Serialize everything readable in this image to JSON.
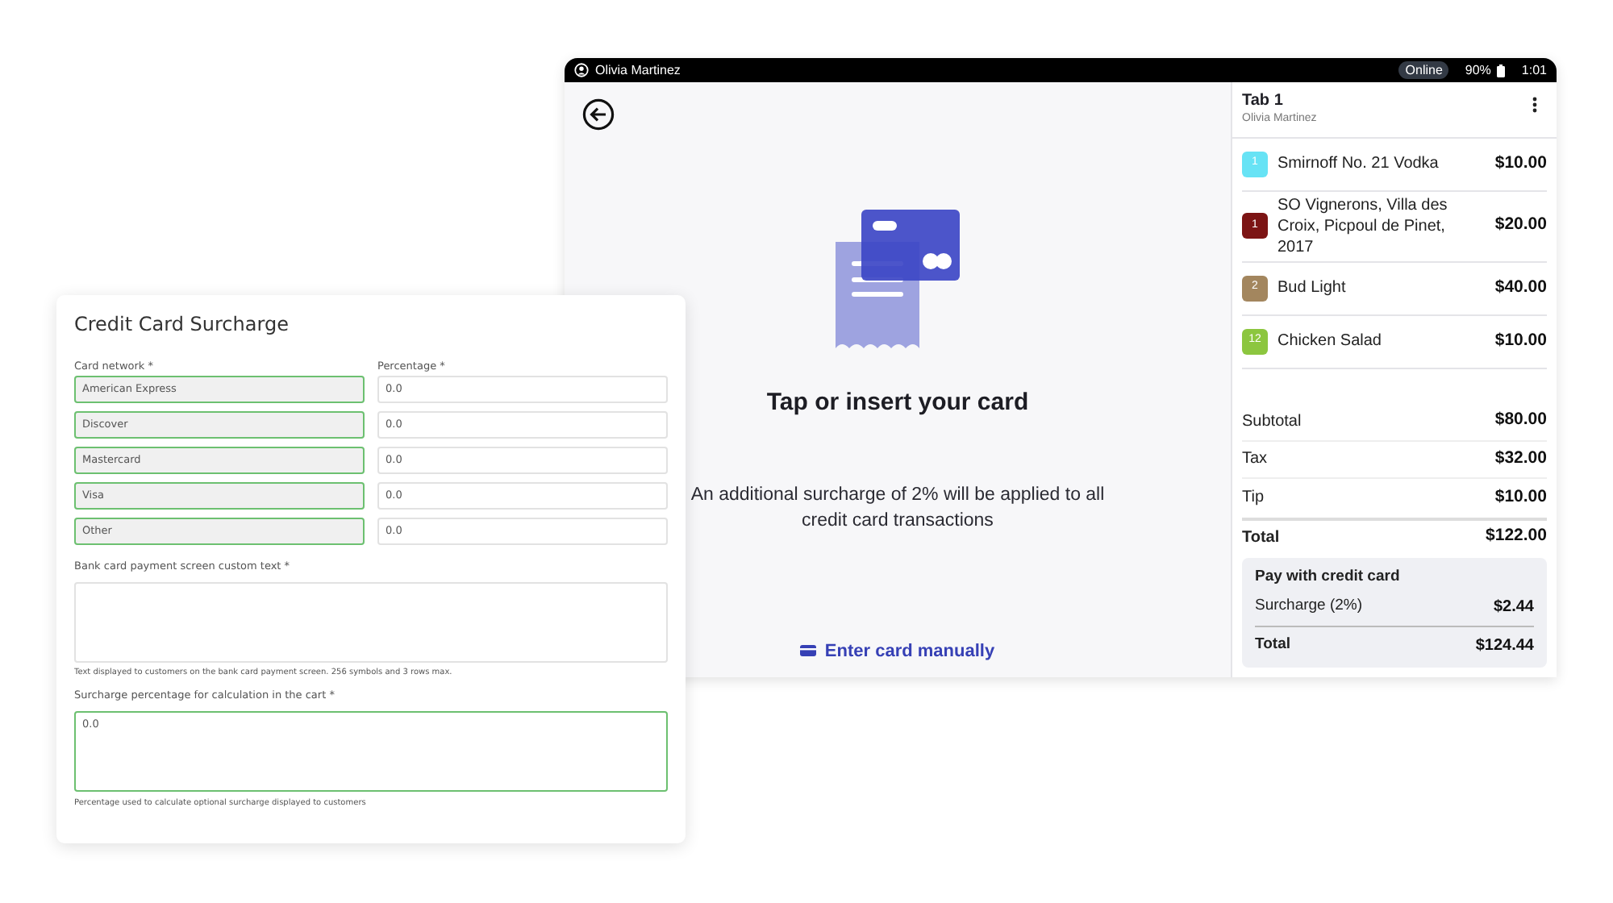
{
  "tablet": {
    "status_bar": {
      "user": "Olivia Martinez",
      "connection": "Online",
      "battery": "90%",
      "time": "1:01"
    },
    "payment": {
      "title": "Tap or insert your card",
      "message": "An additional surcharge of 2% will be applied to all credit card transactions",
      "manual_link": "Enter card manually"
    },
    "tab": {
      "title": "Tab 1",
      "customer": "Olivia Martinez",
      "items": [
        {
          "quantity": "1",
          "name": "Smirnoff No. 21 Vodka",
          "price": "$10.00",
          "color": "#67e3f5"
        },
        {
          "quantity": "1",
          "name": "SO Vignerons, Villa des Croix, Picpoul de Pinet, 2017",
          "price": "$20.00",
          "color": "#7c1414"
        },
        {
          "quantity": "2",
          "name": "Bud Light",
          "price": "$40.00",
          "color": "#a3865e"
        },
        {
          "quantity": "12",
          "name": "Chicken Salad",
          "price": "$10.00",
          "color": "#8cc63f"
        }
      ],
      "totals": [
        {
          "label": "Subtotal",
          "value": "$80.00"
        },
        {
          "label": "Tax",
          "value": "$32.00"
        },
        {
          "label": "Tip",
          "value": "$10.00"
        },
        {
          "label": "Total",
          "value": "$122.00"
        }
      ],
      "credit_card": {
        "title": "Pay with credit card",
        "rows": [
          {
            "label": "Surcharge (2%)",
            "value": "$2.44"
          },
          {
            "label": "Total",
            "value": "$124.44"
          }
        ]
      }
    }
  },
  "settings_form": {
    "title": "Credit Card Surcharge",
    "network_label": "Card network *",
    "percentage_label": "Percentage *",
    "networks": [
      {
        "name": "American Express",
        "percentage": "0.0"
      },
      {
        "name": "Discover",
        "percentage": "0.0"
      },
      {
        "name": "Mastercard",
        "percentage": "0.0"
      },
      {
        "name": "Visa",
        "percentage": "0.0"
      },
      {
        "name": "Other",
        "percentage": "0.0"
      }
    ],
    "custom_text": {
      "label": "Bank card payment screen custom text *",
      "hint": "Text displayed to customers on the bank card payment screen. 256 symbols and 3 rows max."
    },
    "cart_surcharge": {
      "label": "Surcharge percentage for calculation in the cart *",
      "value": "0.0",
      "hint": "Percentage used to calculate optional surcharge displayed to customers"
    }
  }
}
